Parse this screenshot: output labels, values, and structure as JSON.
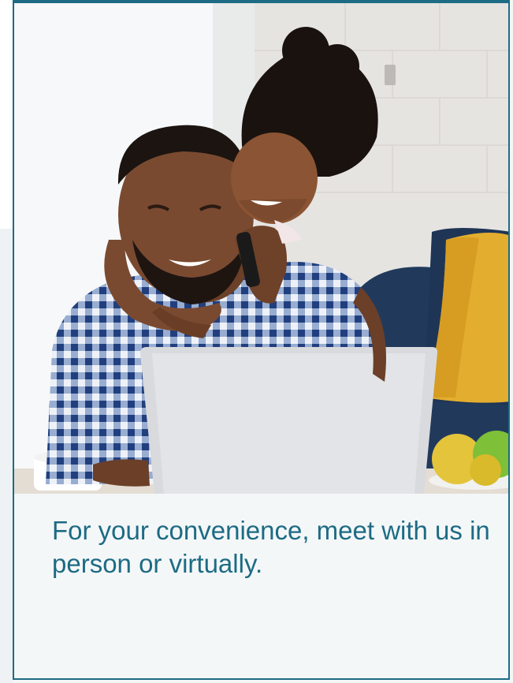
{
  "card": {
    "caption": "For your convenience, meet with us in person or virtually."
  },
  "photo": {
    "icon": "family-photo-icon"
  },
  "colors": {
    "accent": "#1d6b84",
    "card_background": "#f4f7f8",
    "pillow": "#e3ad2f",
    "sofa": "#213a5c"
  }
}
